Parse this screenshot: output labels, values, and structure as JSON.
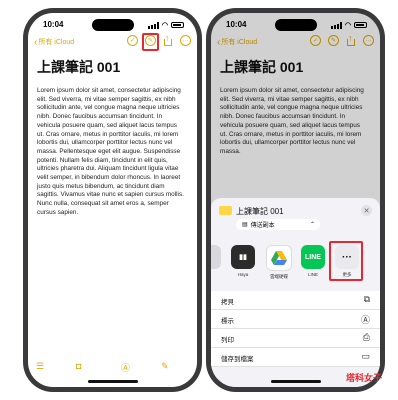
{
  "left_phone": {
    "status_time": "10:04",
    "back_label": "所有 iCloud",
    "toolbar_icons": [
      "checklist-icon",
      "markup-icon",
      "share-icon",
      "more-icon"
    ],
    "note_title": "上課筆記 001",
    "note_body": "Lorem ipsum dolor sit amet, consectetur adipiscing elit. Sed viverra, mi vitae semper sagittis, ex nibh sollicitudin ante, vel congue magna neque ultricies nibh. Donec faucibus accumsan tincidunt. In vehicula posuere quam, sed aliquet lacus tempus ut. Cras ornare, metus in porttitor iaculis, mi lorem lobortis dui, ullamcorper porttitor lectus nunc vel massa. Pellentesque eget elit augue. Suspendisse potenti. Nullam felis diam, tincidunt in elit quis, ultricies pharetra dui. Aliquam tincidunt ligula vitae velit semper, in bibendum dolor rhoncus. In laoreet justo quis metus bibendum, ac tincidunt diam sagittis. Vivamus vitae nunc et sapien cursus mollis. Nunc nulla, consequat sit amet eros a, semper cursus sapien."
  },
  "right_phone": {
    "status_time": "10:04",
    "back_label": "所有 iCloud",
    "note_title": "上課筆記 001",
    "note_body": "Lorem ipsum dolor sit amet, consectetur adipiscing elit. Sed viverra, mi vitae semper sagittis, ex nibh sollicitudin ante, vel congue magna neque ultricies nibh. Donec faucibus accumsan tincidunt. In vehicula posuere quam, sed aliquet lacus tempus ut. Cras ornare, metus in porttitor iaculis, mi lorem lobortis dui, ullamcorper porttitor lectus nunc vel massa.",
    "share_sheet": {
      "title": "上課筆記 001",
      "collab_label": "傳送副本",
      "apps": [
        {
          "label": "Haya",
          "color": "#2b2b2b"
        },
        {
          "label": "雲端硬碟",
          "color": "#ffffff"
        },
        {
          "label": "LINE",
          "color": "#06c755"
        },
        {
          "label": "更多",
          "color": "#e9e9ee"
        }
      ],
      "actions": [
        {
          "label": "拷貝",
          "icon": "copy-icon"
        },
        {
          "label": "標示",
          "icon": "markup-icon"
        },
        {
          "label": "列印",
          "icon": "print-icon"
        },
        {
          "label": "儲存到檔案",
          "icon": "folder-icon"
        }
      ]
    }
  },
  "watermark": "塔科女子",
  "accent_color": "#e0a800",
  "highlight_color": "#e8282e"
}
